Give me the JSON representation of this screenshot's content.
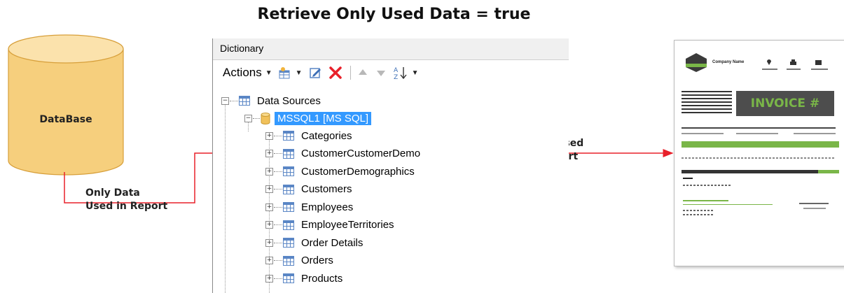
{
  "title": "Retrieve Only Used Data = true",
  "database": {
    "label": "DataBase"
  },
  "notes": {
    "only_data": "Only Data\nUsed in Report",
    "data_used": "Data Used\nin Report"
  },
  "dictionary": {
    "title": "Dictionary",
    "toolbar": {
      "actions_label": "Actions"
    },
    "tree": {
      "root": "Data Sources",
      "source": "MSSQL1 [MS SQL]",
      "tables": [
        "Categories",
        "CustomerCustomerDemo",
        "CustomerDemographics",
        "Customers",
        "Employees",
        "EmployeeTerritories",
        "Order Details",
        "Orders",
        "Products"
      ]
    }
  },
  "report": {
    "company": "Company Name",
    "invoice_title": "INVOICE #"
  },
  "colors": {
    "database": "#f6cf7d",
    "arrow": "#e8202a",
    "selection": "#3399ff",
    "invoice_green": "#7ab648",
    "invoice_dark": "#4d4d4d"
  }
}
